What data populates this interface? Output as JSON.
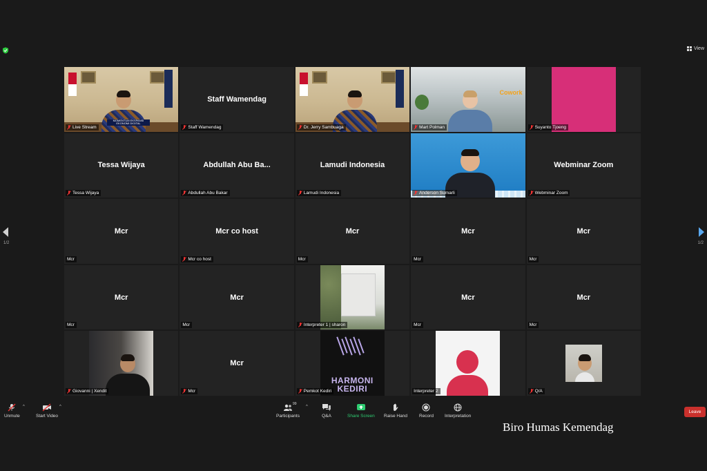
{
  "top_bar": {
    "view_label": "View"
  },
  "pagination": {
    "left": "1/2",
    "right": "1/2"
  },
  "tiles": [
    {
      "name": "Live Stream",
      "lower_third": [
        "MOMENTUM EKSPANSI",
        "EKONOMI DIGITAL"
      ]
    },
    {
      "display_name": "Staff Wamendag",
      "name": "Staff Wamendag"
    },
    {
      "name": "Dr. Jerry Sambuaga"
    },
    {
      "name": "Mart Polman",
      "logo_text": "Cowork"
    },
    {
      "name": "Suyanto Tjoeng"
    },
    {
      "display_name": "Tessa Wijaya",
      "name": "Tessa Wijaya"
    },
    {
      "display_name": "Abdullah Abu Ba...",
      "name": "Abdullah Abu Bakar"
    },
    {
      "display_name": "Lamudi Indonesia",
      "name": "Lamudi Indonesia"
    },
    {
      "name": "Anderson Sumarli"
    },
    {
      "display_name": "Webminar Zoom",
      "name": "Webminar Zoom"
    },
    {
      "display_name": "Mcr",
      "name": "Mcr"
    },
    {
      "display_name": "Mcr co host",
      "name": "Mcr co host"
    },
    {
      "display_name": "Mcr",
      "name": "Mcr"
    },
    {
      "display_name": "Mcr",
      "name": "Mcr"
    },
    {
      "display_name": "Mcr",
      "name": "Mcr"
    },
    {
      "display_name": "Mcr",
      "name": "Mcr"
    },
    {
      "display_name": "Mcr",
      "name": "Mcr"
    },
    {
      "name": "Interpreter 1 | sharon"
    },
    {
      "display_name": "Mcr",
      "name": "Mcr"
    },
    {
      "display_name": "Mcr",
      "name": "Mcr"
    },
    {
      "name": "Giovanni | Xendit"
    },
    {
      "display_name": "Mcr",
      "name": "Mcr"
    },
    {
      "name": "Pemkot Kediri",
      "logo_text": [
        "HARMONI",
        "KEDIRI"
      ]
    },
    {
      "name": "Interpreter 2"
    },
    {
      "name": "Q/A"
    }
  ],
  "toolbar": {
    "unmute": "Unmute",
    "start_video": "Start Video",
    "participants": "Participants",
    "participants_count": "99",
    "qa": "Q&A",
    "share_screen": "Share Screen",
    "raise_hand": "Raise Hand",
    "record": "Record",
    "interpretation": "Interpretation",
    "leave": "Leave"
  },
  "watermark": "Biro Humas Kemendag",
  "colors": {
    "active_speaker": "#e4e02a",
    "share_screen": "#2ecc71",
    "leave": "#c9302c",
    "mic_muted": "#e33333"
  }
}
